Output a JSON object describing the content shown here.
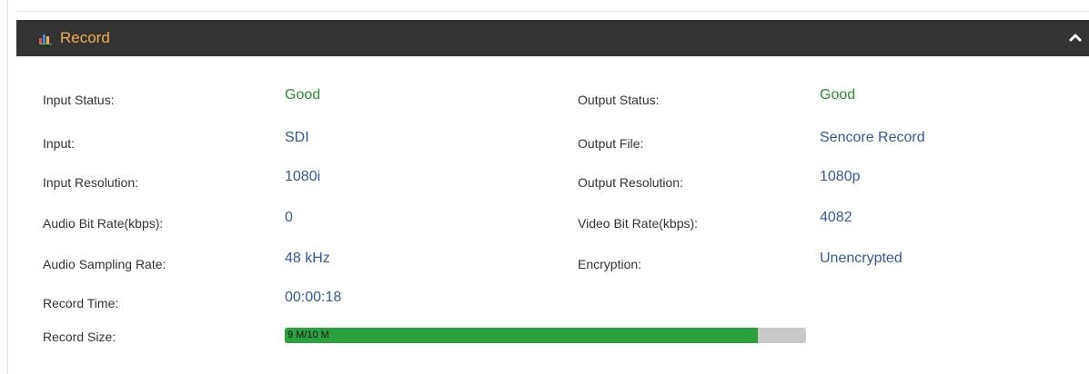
{
  "panel": {
    "title": "Record",
    "title_icon": "bar-chart-icon",
    "collapse_icon": "chevron-up-icon",
    "header_color": "#333333",
    "title_color": "#f0ad4e"
  },
  "left_fields": [
    {
      "label": "Input Status:",
      "value": "Good",
      "status": "good"
    },
    {
      "label": "Input:",
      "value": "SDI"
    },
    {
      "label": "Input Resolution:",
      "value": "1080i"
    },
    {
      "label": "Audio Bit Rate(kbps):",
      "value": "0"
    },
    {
      "label": "Audio Sampling Rate:",
      "value": "48 kHz"
    },
    {
      "label": "Record Time:",
      "value": "00:00:18"
    }
  ],
  "right_fields": [
    {
      "label": "Output Status:",
      "value": "Good",
      "status": "good"
    },
    {
      "label": "Output File:",
      "value": "Sencore Record"
    },
    {
      "label": "Output Resolution:",
      "value": "1080p"
    },
    {
      "label": "Video Bit Rate(kbps):",
      "value": "4082"
    },
    {
      "label": "Encryption:",
      "value": "Unencrypted"
    }
  ],
  "record_size": {
    "label": "Record Size:",
    "text": "9 M/10 M",
    "fraction": 0.908,
    "fill_color": "#2aa13c",
    "track_color": "#c9c9c9"
  },
  "colors": {
    "good": "#2e8b2e",
    "value": "#34599c",
    "label": "#333333"
  }
}
